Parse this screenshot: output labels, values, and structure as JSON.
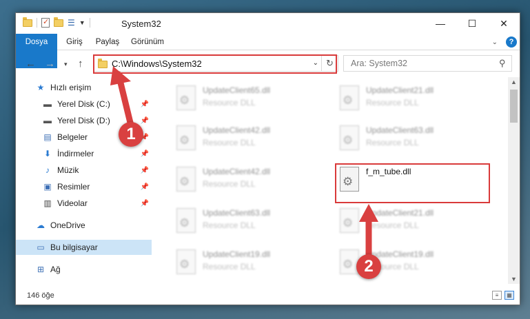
{
  "window": {
    "title": "System32",
    "controls": {
      "minimize": "—",
      "maximize": "☐",
      "close": "✕"
    }
  },
  "ribbon": {
    "tabs": [
      "Dosya",
      "Giriş",
      "Paylaş",
      "Görünüm"
    ],
    "help": "?"
  },
  "nav": {
    "address": "C:\\Windows\\System32",
    "search_placeholder": "Ara: System32"
  },
  "sidebar": {
    "items": [
      {
        "label": "Hızlı erişim",
        "icon": "star-icon",
        "pinned": false
      },
      {
        "label": "Yerel Disk (C:)",
        "icon": "drive-icon",
        "pinned": true
      },
      {
        "label": "Yerel Disk (D:)",
        "icon": "drive-icon",
        "pinned": true
      },
      {
        "label": "Belgeler",
        "icon": "documents-icon",
        "pinned": true
      },
      {
        "label": "İndirmeler",
        "icon": "download-icon",
        "pinned": true
      },
      {
        "label": "Müzik",
        "icon": "music-icon",
        "pinned": true
      },
      {
        "label": "Resimler",
        "icon": "pictures-icon",
        "pinned": true
      },
      {
        "label": "Videolar",
        "icon": "videos-icon",
        "pinned": true
      },
      {
        "label": "OneDrive",
        "icon": "cloud-icon",
        "pinned": false
      },
      {
        "label": "Bu bilgisayar",
        "icon": "computer-icon",
        "pinned": false,
        "selected": true
      },
      {
        "label": "Ağ",
        "icon": "network-icon",
        "pinned": false
      }
    ]
  },
  "files": [
    {
      "name": "UpdateClient65.dll",
      "type": "Resource DLL",
      "blurred": true
    },
    {
      "name": "UpdateClient21.dll",
      "type": "Resource DLL",
      "blurred": true
    },
    {
      "name": "UpdateClient42.dll",
      "type": "Resource DLL",
      "blurred": true
    },
    {
      "name": "UpdateClient63.dll",
      "type": "Resource DLL",
      "blurred": true
    },
    {
      "name": "UpdateClient42.dll",
      "type": "Resource DLL",
      "blurred": true
    },
    {
      "name": "f_m_tube.dll",
      "type": "",
      "blurred": false
    },
    {
      "name": "UpdateClient63.dll",
      "type": "Resource DLL",
      "blurred": true
    },
    {
      "name": "UpdateClient21.dll",
      "type": "Resource DLL",
      "blurred": true
    },
    {
      "name": "UpdateClient19.dll",
      "type": "Resource DLL",
      "blurred": true
    },
    {
      "name": "UpdateClient19.dll",
      "type": "Resource DLL",
      "blurred": true
    }
  ],
  "status": {
    "count": "146 öğe"
  },
  "callouts": [
    "1",
    "2"
  ],
  "colors": {
    "accent": "#1979ca",
    "highlight": "#d93a3a",
    "callout": "#d94040"
  }
}
